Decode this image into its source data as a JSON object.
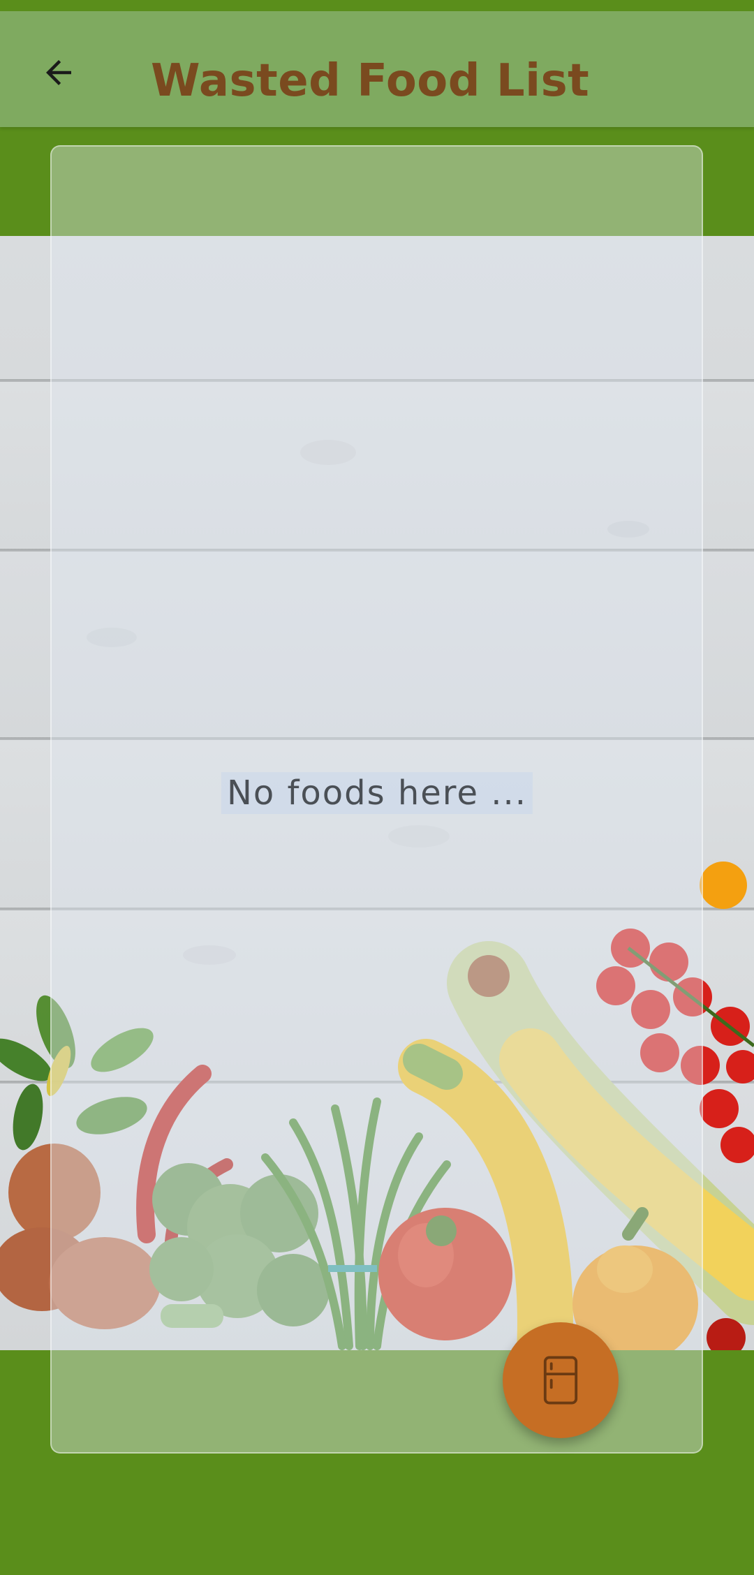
{
  "app_bar": {
    "title": "Wasted Food List",
    "back_icon": "arrow-back-icon"
  },
  "list": {
    "empty_message": "No foods here ..."
  },
  "fab": {
    "icon": "fridge-icon"
  },
  "colors": {
    "screen_background": "#5a8e1b",
    "app_bar_background": "#7faa60",
    "title_color": "#7a4a1f",
    "fab_background": "#c66e24",
    "empty_text_color": "#4a4f55"
  }
}
